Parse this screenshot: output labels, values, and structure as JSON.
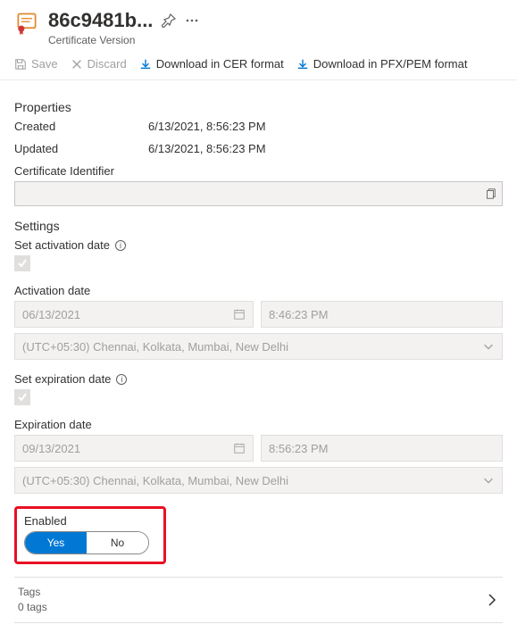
{
  "header": {
    "title": "86c9481b...",
    "subtitle": "Certificate Version"
  },
  "toolbar": {
    "save": "Save",
    "discard": "Discard",
    "download_cer": "Download in CER format",
    "download_pfx": "Download in PFX/PEM format"
  },
  "properties": {
    "heading": "Properties",
    "created_label": "Created",
    "created_value": "6/13/2021, 8:56:23 PM",
    "updated_label": "Updated",
    "updated_value": "6/13/2021, 8:56:23 PM",
    "cert_id_label": "Certificate Identifier"
  },
  "settings": {
    "heading": "Settings",
    "activation_toggle_label": "Set activation date",
    "activation_date_label": "Activation date",
    "activation_date": "06/13/2021",
    "activation_time": "8:46:23 PM",
    "activation_tz": "(UTC+05:30) Chennai, Kolkata, Mumbai, New Delhi",
    "expiration_toggle_label": "Set expiration date",
    "expiration_date_label": "Expiration date",
    "expiration_date": "09/13/2021",
    "expiration_time": "8:56:23 PM",
    "expiration_tz": "(UTC+05:30) Chennai, Kolkata, Mumbai, New Delhi",
    "enabled_label": "Enabled",
    "enabled_yes": "Yes",
    "enabled_no": "No"
  },
  "tags": {
    "label": "Tags",
    "count": "0 tags"
  }
}
